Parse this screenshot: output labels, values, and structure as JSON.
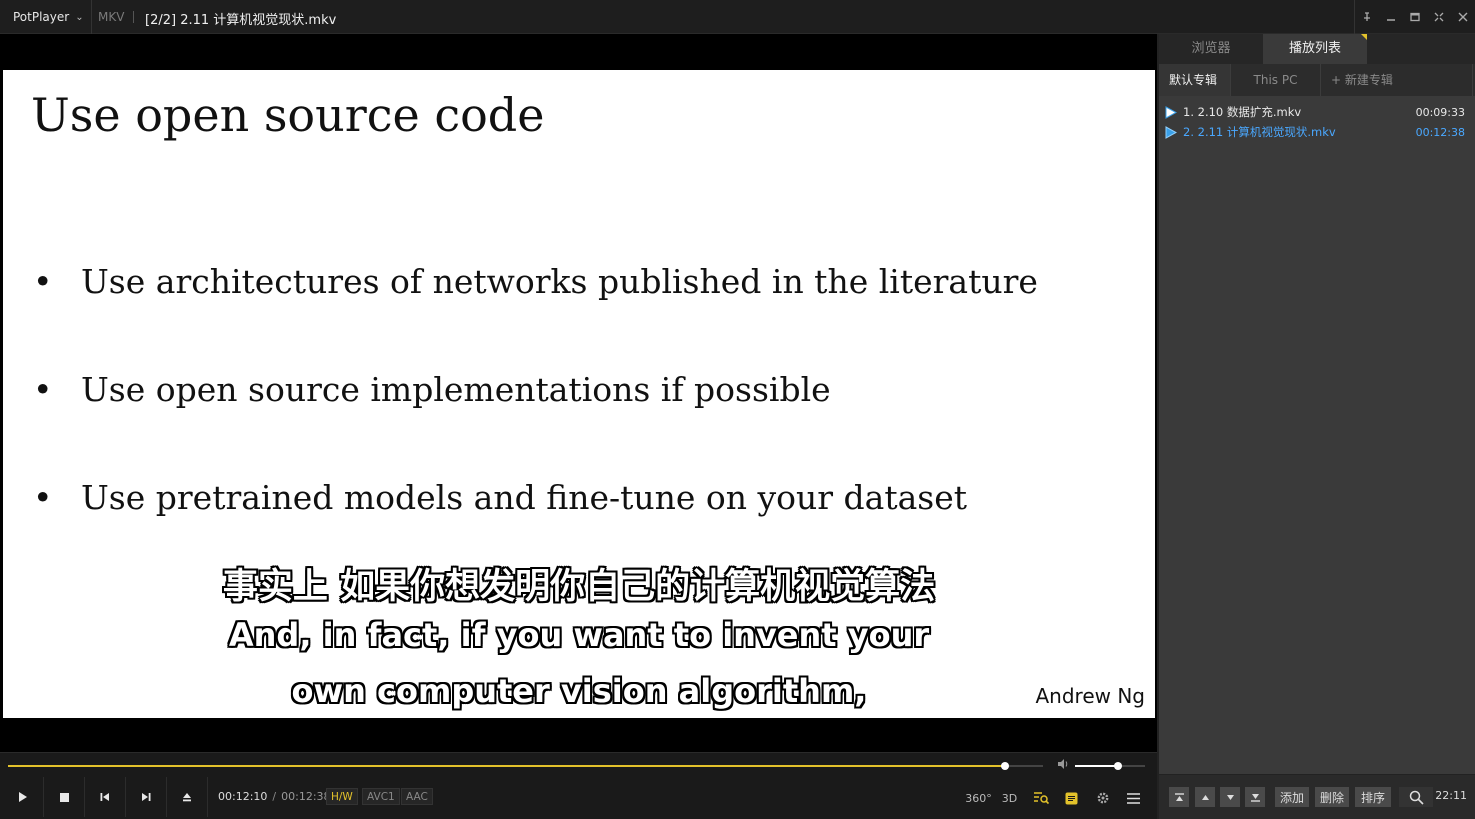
{
  "titlebar": {
    "app_name": "PotPlayer",
    "format": "MKV",
    "file_title": "[2/2] 2.11 计算机视觉现状.mkv"
  },
  "slide": {
    "title": "Use open source code",
    "bullets": [
      "Use architectures of networks published in the literature",
      "Use open source implementations if possible",
      "Use pretrained models and fine-tune on your dataset"
    ],
    "author": "Andrew Ng"
  },
  "subtitles": {
    "chinese": "事实上 如果你想发明你自己的计算机视觉算法",
    "english_line1": "And, in fact, if you want to invent your",
    "english_line2": "own computer vision algorithm,"
  },
  "playback": {
    "current_time": "00:12:10",
    "separator": "/",
    "duration": "00:12:38",
    "progress_fraction": 0.963,
    "volume_fraction": 0.61,
    "badges": [
      "H/W",
      "AVC1",
      "AAC"
    ],
    "right_controls": [
      "360°",
      "3D"
    ]
  },
  "panel": {
    "tabs": [
      "浏览器",
      "播放列表"
    ],
    "active_tab": 1,
    "subtabs": [
      "默认专辑",
      "This PC",
      "+ 新建专辑"
    ],
    "playlist": [
      {
        "name": "1. 2.10 数据扩充.mkv",
        "duration": "00:09:33",
        "current": false
      },
      {
        "name": "2. 2.11 计算机视觉现状.mkv",
        "duration": "00:12:38",
        "current": true
      }
    ],
    "bottom_buttons": [
      "添加",
      "删除",
      "排序"
    ],
    "clock": "22:11"
  },
  "colors": {
    "accent": "#e3c22b",
    "current_item": "#4aa8ff",
    "panel_bg": "#3a3a3a"
  }
}
